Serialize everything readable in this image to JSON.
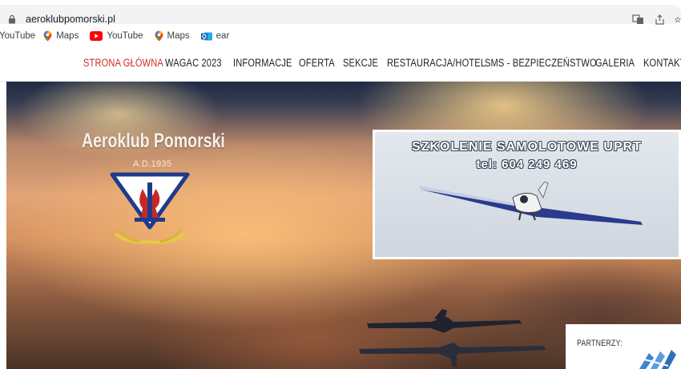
{
  "browser": {
    "url": "aeroklubpomorski.pl"
  },
  "bookmarks": [
    {
      "label": "YouTube",
      "icon": "none"
    },
    {
      "label": "Maps",
      "icon": "maps-pin-icon"
    },
    {
      "label": "YouTube",
      "icon": "youtube-icon"
    },
    {
      "label": "Maps",
      "icon": "maps-pin-icon"
    },
    {
      "label": "ear",
      "icon": "outlook-icon"
    }
  ],
  "nav": {
    "items": [
      {
        "label": "STRONA GŁÓWNA",
        "active": true
      },
      {
        "label": "WAGAC 2023"
      },
      {
        "label": "INFORMACJE"
      },
      {
        "label": "OFERTA"
      },
      {
        "label": "SEKCJE"
      },
      {
        "label": "RESTAURACJA/HOTEL"
      },
      {
        "label": "SMS - BEZPIECZEŃSTWO"
      },
      {
        "label": "GALERIA"
      },
      {
        "label": "KONTAKT"
      }
    ]
  },
  "hero": {
    "title": "Aeroklub Pomorski",
    "subtitle": "A.D.1935",
    "promo_line1": "SZKOLENIE SAMOLOTOWE UPRT",
    "promo_line2": "tel: 604 249 469"
  },
  "partners": {
    "title": "PARTNERZY:"
  },
  "colors": {
    "nav_active": "#d02b2b",
    "nav_text": "#222222",
    "emblem_blue": "#1f3a8a",
    "emblem_red": "#c62828"
  }
}
